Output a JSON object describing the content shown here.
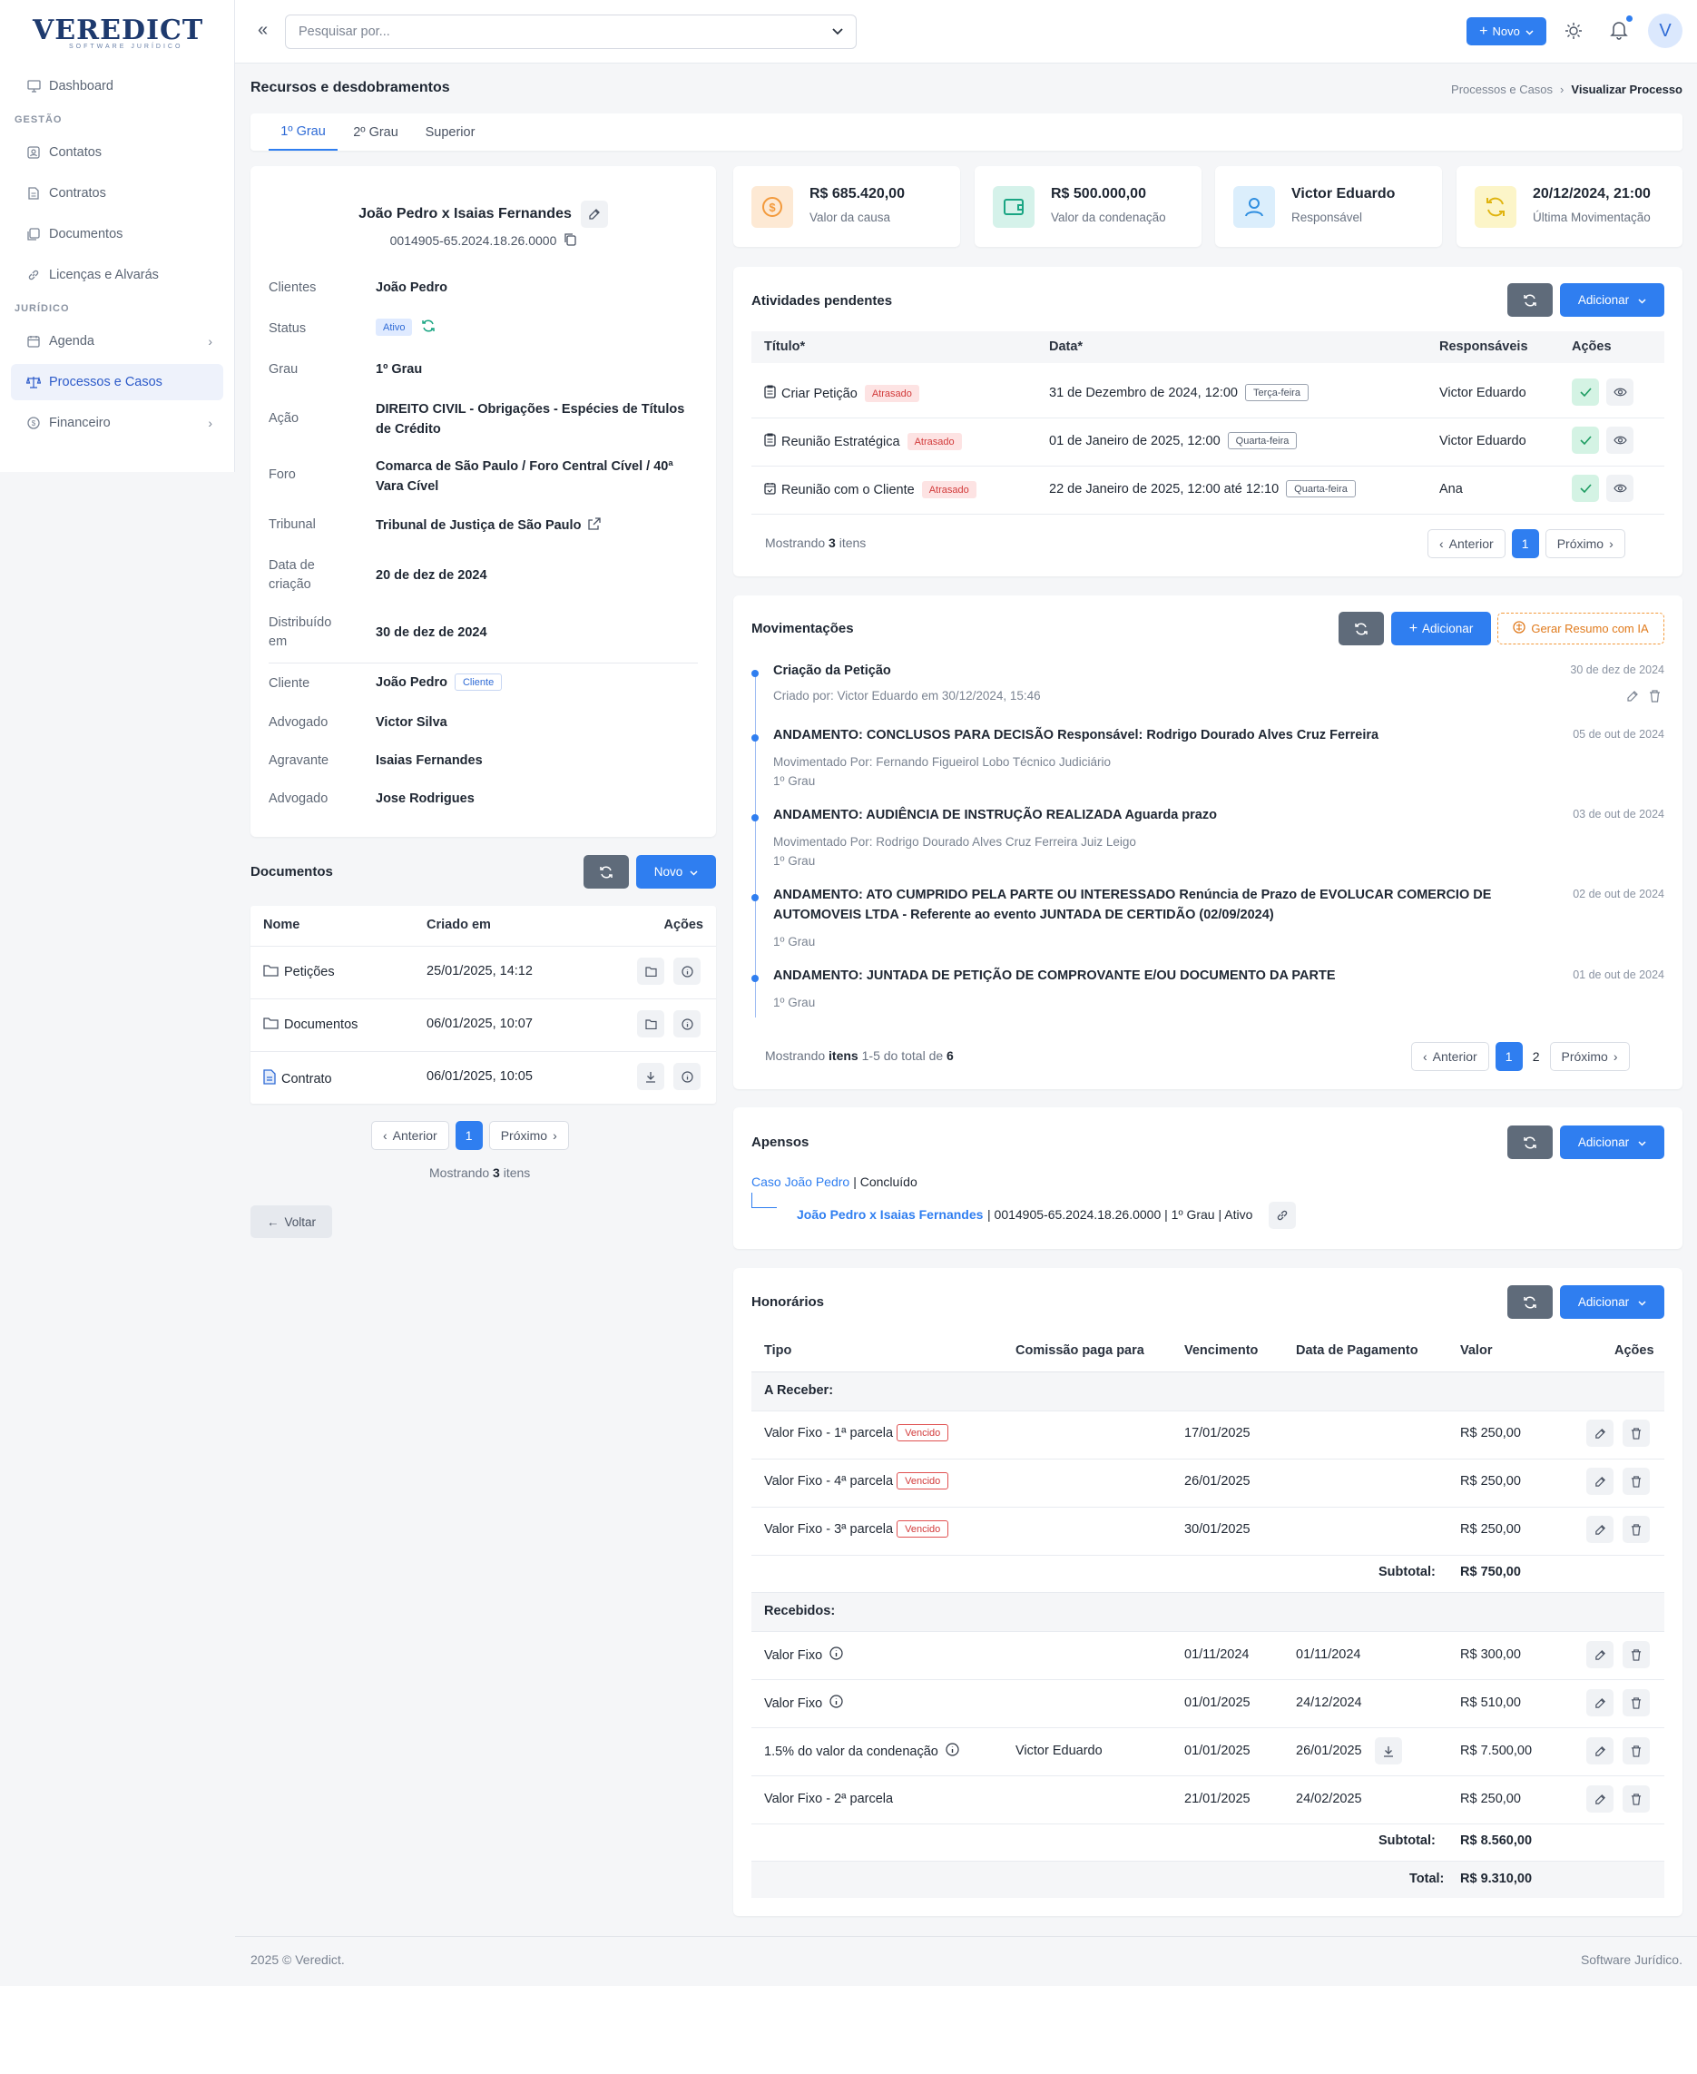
{
  "brand": {
    "logo": "VEREDICT",
    "tagline": "SOFTWARE JURÍDICO"
  },
  "sidebar": {
    "dashboard": "Dashboard",
    "section_gestao": "GESTÃO",
    "contatos": "Contatos",
    "contratos": "Contratos",
    "documentos": "Documentos",
    "licencas": "Licenças e Alvarás",
    "section_juridico": "JURÍDICO",
    "agenda": "Agenda",
    "processos": "Processos e Casos",
    "financeiro": "Financeiro"
  },
  "topbar": {
    "search_placeholder": "Pesquisar por...",
    "new_button": "Novo",
    "avatar": "V"
  },
  "page": {
    "title": "Recursos e desdobramentos",
    "breadcrumb_parent": "Processos e Casos",
    "breadcrumb_current": "Visualizar Processo"
  },
  "tabs": [
    "1º Grau",
    "2º Grau",
    "Superior"
  ],
  "process": {
    "title": "João Pedro x Isaias Fernandes",
    "number": "0014905-65.2024.18.26.0000",
    "fields": [
      {
        "label": "Clientes",
        "value": "João Pedro"
      },
      {
        "label": "Status",
        "value": "Ativo"
      },
      {
        "label": "Grau",
        "value": "1º Grau"
      },
      {
        "label": "Ação",
        "value": "DIREITO CIVIL - Obrigações - Espécies de Títulos de Crédito"
      },
      {
        "label": "Foro",
        "value": "Comarca de São Paulo / Foro Central Cível / 40ª Vara Cível"
      },
      {
        "label": "Tribunal",
        "value": "Tribunal de Justiça de São Paulo"
      },
      {
        "label": "Data de criação",
        "value": "20 de dez de 2024"
      },
      {
        "label": "Distribuído em",
        "value": "30 de dez de 2024"
      }
    ],
    "parties": [
      {
        "label": "Cliente",
        "value": "João Pedro",
        "badge": "Cliente"
      },
      {
        "label": "Advogado",
        "value": "Victor Silva"
      },
      {
        "label": "Agravante",
        "value": "Isaias Fernandes"
      },
      {
        "label": "Advogado",
        "value": "Jose Rodrigues"
      }
    ]
  },
  "documents": {
    "title": "Documentos",
    "new_button": "Novo",
    "headers": [
      "Nome",
      "Criado em",
      "Ações"
    ],
    "rows": [
      {
        "name": "Petições",
        "date": "25/01/2025, 14:12"
      },
      {
        "name": "Documentos",
        "date": "06/01/2025, 10:07"
      },
      {
        "name": "Contrato",
        "date": "06/01/2025, 10:05"
      }
    ],
    "prev": "Anterior",
    "page": "1",
    "next": "Próximo",
    "showing_pre": "Mostrando",
    "showing_count": "3",
    "showing_post": "itens",
    "back": "Voltar"
  },
  "stats": [
    {
      "value": "R$ 685.420,00",
      "label": "Valor da causa",
      "color": "#f39a3c",
      "bg": "#fde9d4"
    },
    {
      "value": "R$ 500.000,00",
      "label": "Valor da condenação",
      "color": "#1aa583",
      "bg": "#d5f2ea"
    },
    {
      "value": "Victor Eduardo",
      "label": "Responsável",
      "color": "#2f8ee0",
      "bg": "#dbeefc"
    },
    {
      "value": "20/12/2024, 21:00",
      "label": "Última Movimentação",
      "color": "#e0b40f",
      "bg": "#fcf5c8"
    }
  ],
  "activities": {
    "title": "Atividades pendentes",
    "add": "Adicionar",
    "headers": [
      "Título*",
      "Data*",
      "Responsáveis",
      "Ações"
    ],
    "rows": [
      {
        "title": "Criar Petição",
        "badge": "Atrasado",
        "date": "31 de Dezembro de 2024, 12:00",
        "day": "Terça-feira",
        "resp": "Victor Eduardo"
      },
      {
        "title": "Reunião Estratégica",
        "badge": "Atrasado",
        "date": "01 de Janeiro de 2025, 12:00",
        "day": "Quarta-feira",
        "resp": "Victor Eduardo"
      },
      {
        "title": "Reunião com o Cliente",
        "badge": "Atrasado",
        "date": "22 de Janeiro de 2025, 12:00 até 12:10",
        "day": "Quarta-feira",
        "resp": "Ana"
      }
    ],
    "showing_pre": "Mostrando",
    "showing_count": "3",
    "showing_post": "itens",
    "prev": "Anterior",
    "page": "1",
    "next": "Próximo"
  },
  "movements": {
    "title": "Movimentações",
    "add": "Adicionar",
    "ai": "Gerar Resumo com IA",
    "items": [
      {
        "title": "Criação da Petição",
        "lines": [
          "Criado por: Victor Eduardo em 30/12/2024, 15:46"
        ],
        "date": "30 de dez de 2024"
      },
      {
        "title": "ANDAMENTO: CONCLUSOS PARA DECISÃO Responsável: Rodrigo Dourado Alves Cruz Ferreira",
        "lines": [
          "Movimentado Por: Fernando Figueirol Lobo Técnico Judiciário",
          "1º Grau"
        ],
        "date": "05 de out de 2024"
      },
      {
        "title": "ANDAMENTO: AUDIÊNCIA DE INSTRUÇÃO REALIZADA Aguarda prazo",
        "lines": [
          "Movimentado Por: Rodrigo Dourado Alves Cruz Ferreira Juiz Leigo",
          "1º Grau"
        ],
        "date": "03 de out de 2024"
      },
      {
        "title": "ANDAMENTO: ATO CUMPRIDO PELA PARTE OU INTERESSADO Renúncia de Prazo de EVOLUCAR COMERCIO DE AUTOMOVEIS LTDA - Referente ao evento JUNTADA DE CERTIDÃO (02/09/2024)",
        "lines": [
          "1º Grau"
        ],
        "date": "02 de out de 2024"
      },
      {
        "title": "ANDAMENTO: JUNTADA DE PETIÇÃO DE COMPROVANTE E/OU DOCUMENTO DA PARTE",
        "lines": [
          "1º Grau"
        ],
        "date": "01 de out de 2024"
      }
    ],
    "showing_pre": "Mostrando",
    "showing_bold": "itens",
    "showing_mid": "1-5 do total de",
    "showing_total": "6",
    "prev": "Anterior",
    "page1": "1",
    "page2": "2",
    "next": "Próximo"
  },
  "apensos": {
    "title": "Apensos",
    "add": "Adicionar",
    "parent_link": "Caso João Pedro",
    "parent_status": "| Concluído",
    "child_link": "João Pedro x Isaias Fernandes",
    "child_info": "| 0014905-65.2024.18.26.0000 | 1º Grau | Ativo"
  },
  "honorarios": {
    "title": "Honorários",
    "add": "Adicionar",
    "headers": [
      "Tipo",
      "Comissão paga para",
      "Vencimento",
      "Data de Pagamento",
      "Valor",
      "Ações"
    ],
    "receber_label": "A Receber:",
    "receber": [
      {
        "tipo": "Valor Fixo - 1ª parcela",
        "badge": "Vencido",
        "venc": "17/01/2025",
        "valor": "R$ 250,00"
      },
      {
        "tipo": "Valor Fixo - 4ª parcela",
        "badge": "Vencido",
        "venc": "26/01/2025",
        "valor": "R$ 250,00"
      },
      {
        "tipo": "Valor Fixo - 3ª parcela",
        "badge": "Vencido",
        "venc": "30/01/2025",
        "valor": "R$ 250,00"
      }
    ],
    "subtotal_label": "Subtotal:",
    "subtotal_receber": "R$ 750,00",
    "recebidos_label": "Recebidos:",
    "recebidos": [
      {
        "tipo": "Valor Fixo",
        "info": true,
        "comissao": "",
        "venc": "01/11/2024",
        "pag": "01/11/2024",
        "valor": "R$ 300,00"
      },
      {
        "tipo": "Valor Fixo",
        "info": true,
        "comissao": "",
        "venc": "01/01/2025",
        "pag": "24/12/2024",
        "valor": "R$ 510,00"
      },
      {
        "tipo": "1.5% do valor da condenação",
        "info": true,
        "comissao": "Victor Eduardo",
        "venc": "01/01/2025",
        "pag": "26/01/2025",
        "valor": "R$ 7.500,00"
      },
      {
        "tipo": "Valor Fixo - 2ª parcela",
        "info": false,
        "comissao": "",
        "venc": "21/01/2025",
        "pag": "24/02/2025",
        "valor": "R$ 250,00"
      }
    ],
    "subtotal_recebidos": "R$ 8.560,00",
    "total_label": "Total:",
    "total": "R$ 9.310,00"
  },
  "footer": {
    "left": "2025 © Veredict.",
    "right": "Software Jurídico."
  }
}
